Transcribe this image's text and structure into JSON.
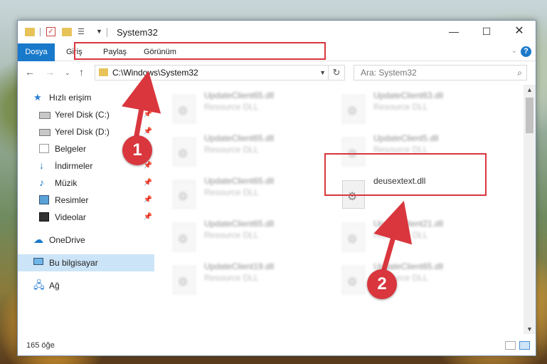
{
  "window": {
    "title": "System32",
    "controls": {
      "minimize": "—",
      "maximize": "☐",
      "close": "✕"
    }
  },
  "ribbon": {
    "tabs": [
      "Dosya",
      "Giriş",
      "Paylaş",
      "Görünüm"
    ]
  },
  "navigation": {
    "address": "C:\\Windows\\System32",
    "search_placeholder": "Ara: System32"
  },
  "sidebar": {
    "items": [
      {
        "label": "Hızlı erişim",
        "icon": "star-icon"
      },
      {
        "label": "Yerel Disk (C:)",
        "icon": "drive-icon",
        "pinned": true
      },
      {
        "label": "Yerel Disk (D:)",
        "icon": "drive-icon",
        "pinned": true
      },
      {
        "label": "Belgeler",
        "icon": "documents-icon",
        "pinned": true
      },
      {
        "label": "İndirmeler",
        "icon": "download-icon",
        "pinned": true
      },
      {
        "label": "Müzik",
        "icon": "music-icon",
        "pinned": true
      },
      {
        "label": "Resimler",
        "icon": "pictures-icon",
        "pinned": true
      },
      {
        "label": "Videolar",
        "icon": "videos-icon",
        "pinned": true
      },
      {
        "label": "OneDrive",
        "icon": "cloud-icon"
      },
      {
        "label": "Bu bilgisayar",
        "icon": "computer-icon",
        "selected": true
      },
      {
        "label": "Ağ",
        "icon": "network-icon"
      }
    ]
  },
  "files": [
    {
      "name": "UpdateClient65.dll",
      "type": "Resource DLL"
    },
    {
      "name": "UpdateClient63.dll",
      "type": "Resource DLL"
    },
    {
      "name": "UpdateClient65.dll",
      "type": "Resource DLL"
    },
    {
      "name": "UpdateClient5.dll",
      "type": "Resource DLL"
    },
    {
      "name": "UpdateClient65.dll",
      "type": "Resource DLL"
    },
    {
      "name": "deusextext.dll",
      "type": ""
    },
    {
      "name": "UpdateClient65.dll",
      "type": "Resource DLL"
    },
    {
      "name": "UpdateClient21.dll",
      "type": "Resource DLL"
    },
    {
      "name": "UpdateClient19.dll",
      "type": "Resource DLL"
    },
    {
      "name": "UpdateClient65.dll",
      "type": "Resource DLL"
    }
  ],
  "status": {
    "count": "165 öğe"
  },
  "callouts": [
    "1",
    "2"
  ],
  "colors": {
    "accent": "#1979ca",
    "highlight": "#d9363e"
  }
}
